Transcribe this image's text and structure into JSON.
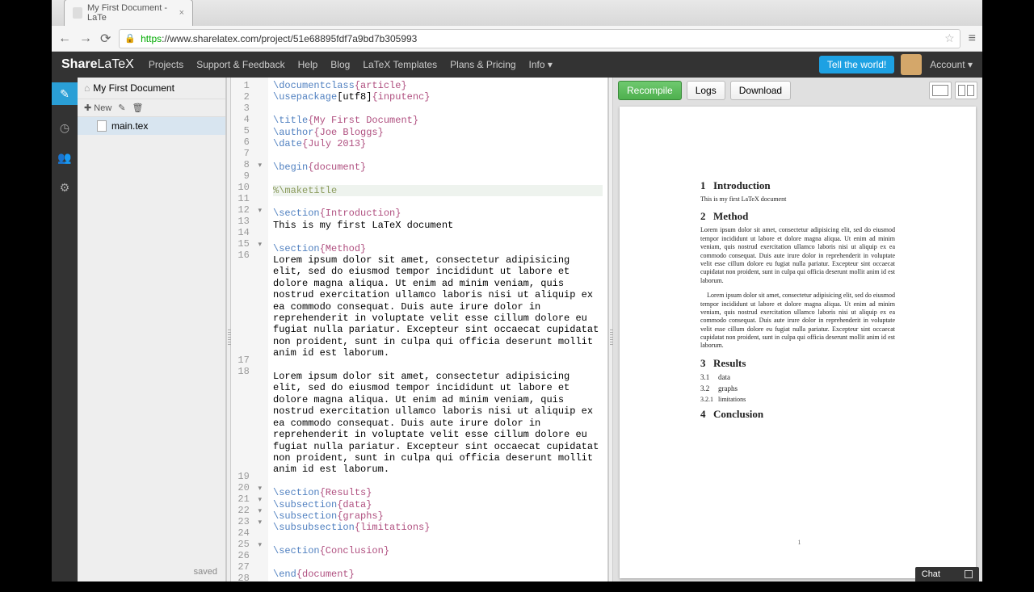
{
  "browser": {
    "tab_title": "My First Document - LaTe",
    "url_proto": "https",
    "url_rest": "://www.sharelatex.com/project/51e68895fdf7a9bd7b305993"
  },
  "header": {
    "brand_a": "Share",
    "brand_b": "LaTeX",
    "links": [
      "Projects",
      "Support & Feedback",
      "Help",
      "Blog",
      "LaTeX Templates",
      "Plans & Pricing",
      "Info"
    ],
    "tell": "Tell the world!",
    "account": "Account"
  },
  "filetree": {
    "project": "My First Document",
    "new": "New",
    "file": "main.tex",
    "status": "saved"
  },
  "editor": {
    "lines": [
      {
        "n": "1",
        "fold": "",
        "parts": [
          {
            "t": "\\documentclass",
            "c": "s-cmd"
          },
          {
            "t": "{article}",
            "c": "s-brace"
          }
        ]
      },
      {
        "n": "2",
        "fold": "",
        "parts": [
          {
            "t": "\\usepackage",
            "c": "s-cmd"
          },
          {
            "t": "[utf8]",
            "c": ""
          },
          {
            "t": "{inputenc}",
            "c": "s-brace"
          }
        ]
      },
      {
        "n": "3",
        "fold": "",
        "parts": []
      },
      {
        "n": "4",
        "fold": "",
        "parts": [
          {
            "t": "\\title",
            "c": "s-cmd"
          },
          {
            "t": "{My First Document}",
            "c": "s-brace"
          }
        ]
      },
      {
        "n": "5",
        "fold": "",
        "parts": [
          {
            "t": "\\author",
            "c": "s-cmd"
          },
          {
            "t": "{Joe Bloggs}",
            "c": "s-brace"
          }
        ]
      },
      {
        "n": "6",
        "fold": "",
        "parts": [
          {
            "t": "\\date",
            "c": "s-cmd"
          },
          {
            "t": "{July 2013}",
            "c": "s-brace"
          }
        ]
      },
      {
        "n": "7",
        "fold": "",
        "parts": []
      },
      {
        "n": "8",
        "fold": "▾",
        "parts": [
          {
            "t": "\\begin",
            "c": "s-cmd"
          },
          {
            "t": "{document}",
            "c": "s-brace"
          }
        ]
      },
      {
        "n": "9",
        "fold": "",
        "parts": []
      },
      {
        "n": "10",
        "fold": "",
        "hl": true,
        "parts": [
          {
            "t": "%\\maketitle",
            "c": "s-comment"
          }
        ]
      },
      {
        "n": "11",
        "fold": "",
        "parts": []
      },
      {
        "n": "12",
        "fold": "▾",
        "parts": [
          {
            "t": "\\section",
            "c": "s-cmd"
          },
          {
            "t": "{Introduction}",
            "c": "s-brace"
          }
        ]
      },
      {
        "n": "13",
        "fold": "",
        "parts": [
          {
            "t": "This is my first LaTeX document",
            "c": ""
          }
        ]
      },
      {
        "n": "14",
        "fold": "",
        "parts": []
      },
      {
        "n": "15",
        "fold": "▾",
        "parts": [
          {
            "t": "\\section",
            "c": "s-cmd"
          },
          {
            "t": "{Method}",
            "c": "s-brace"
          }
        ]
      },
      {
        "n": "16",
        "fold": "",
        "parts": [
          {
            "t": "Lorem ipsum dolor sit amet, consectetur adipisicing elit, sed do eiusmod tempor incididunt ut labore et dolore magna aliqua. Ut enim ad minim veniam, quis nostrud exercitation ullamco laboris nisi ut aliquip ex ea commodo consequat. Duis aute irure dolor in reprehenderit in voluptate velit esse cillum dolore eu fugiat nulla pariatur. Excepteur sint occaecat cupidatat non proident, sunt in culpa qui officia deserunt mollit anim id est laborum.",
            "c": ""
          }
        ]
      },
      {
        "n": "17",
        "fold": "",
        "parts": []
      },
      {
        "n": "18",
        "fold": "",
        "parts": [
          {
            "t": "Lorem ipsum dolor sit amet, consectetur adipisicing elit, sed do eiusmod tempor incididunt ut labore et dolore magna aliqua. Ut enim ad minim veniam, quis nostrud exercitation ullamco laboris nisi ut aliquip ex ea commodo consequat. Duis aute irure dolor in reprehenderit in voluptate velit esse cillum dolore eu fugiat nulla pariatur. Excepteur sint occaecat cupidatat non proident, sunt in culpa qui officia deserunt mollit anim id est laborum.",
            "c": ""
          }
        ]
      },
      {
        "n": "19",
        "fold": "",
        "parts": []
      },
      {
        "n": "20",
        "fold": "▾",
        "parts": [
          {
            "t": "\\section",
            "c": "s-cmd"
          },
          {
            "t": "{Results}",
            "c": "s-brace"
          }
        ]
      },
      {
        "n": "21",
        "fold": "▾",
        "parts": [
          {
            "t": "\\subsection",
            "c": "s-cmd"
          },
          {
            "t": "{data}",
            "c": "s-brace"
          }
        ]
      },
      {
        "n": "22",
        "fold": "▾",
        "parts": [
          {
            "t": "\\subsection",
            "c": "s-cmd"
          },
          {
            "t": "{graphs}",
            "c": "s-brace"
          }
        ]
      },
      {
        "n": "23",
        "fold": "▾",
        "parts": [
          {
            "t": "\\subsubsection",
            "c": "s-cmd"
          },
          {
            "t": "{limitations}",
            "c": "s-brace"
          }
        ]
      },
      {
        "n": "24",
        "fold": "",
        "parts": []
      },
      {
        "n": "25",
        "fold": "▾",
        "parts": [
          {
            "t": "\\section",
            "c": "s-cmd"
          },
          {
            "t": "{Conclusion}",
            "c": "s-brace"
          }
        ]
      },
      {
        "n": "26",
        "fold": "",
        "parts": []
      },
      {
        "n": "27",
        "fold": "",
        "parts": [
          {
            "t": "\\end",
            "c": "s-cmd"
          },
          {
            "t": "{document}",
            "c": "s-brace"
          }
        ]
      },
      {
        "n": "28",
        "fold": "",
        "parts": []
      }
    ]
  },
  "preview": {
    "recompile": "Recompile",
    "logs": "Logs",
    "download": "Download",
    "sections": {
      "s1n": "1",
      "s1": "Introduction",
      "s1body": "This is my first LaTeX document",
      "s2n": "2",
      "s2": "Method",
      "s2body": "Lorem ipsum dolor sit amet, consectetur adipisicing elit, sed do eiusmod tempor incididunt ut labore et dolore magna aliqua. Ut enim ad minim veniam, quis nostrud exercitation ullamco laboris nisi ut aliquip ex ea commodo consequat. Duis aute irure dolor in reprehenderit in voluptate velit esse cillum dolore eu fugiat nulla pariatur. Excepteur sint occaecat cupidatat non proident, sunt in culpa qui officia deserunt mollit anim id est laborum.",
      "s2body2": "    Lorem ipsum dolor sit amet, consectetur adipisicing elit, sed do eiusmod tempor incididunt ut labore et dolore magna aliqua. Ut enim ad minim veniam, quis nostrud exercitation ullamco laboris nisi ut aliquip ex ea commodo consequat. Duis aute irure dolor in reprehenderit in voluptate velit esse cillum dolore eu fugiat nulla pariatur. Excepteur sint occaecat cupidatat non proident, sunt in culpa qui officia deserunt mollit anim id est laborum.",
      "s3n": "3",
      "s3": "Results",
      "s31n": "3.1",
      "s31": "data",
      "s32n": "3.2",
      "s32": "graphs",
      "s321n": "3.2.1",
      "s321": "limitations",
      "s4n": "4",
      "s4": "Conclusion",
      "pgnum": "1"
    }
  },
  "chat": "Chat"
}
